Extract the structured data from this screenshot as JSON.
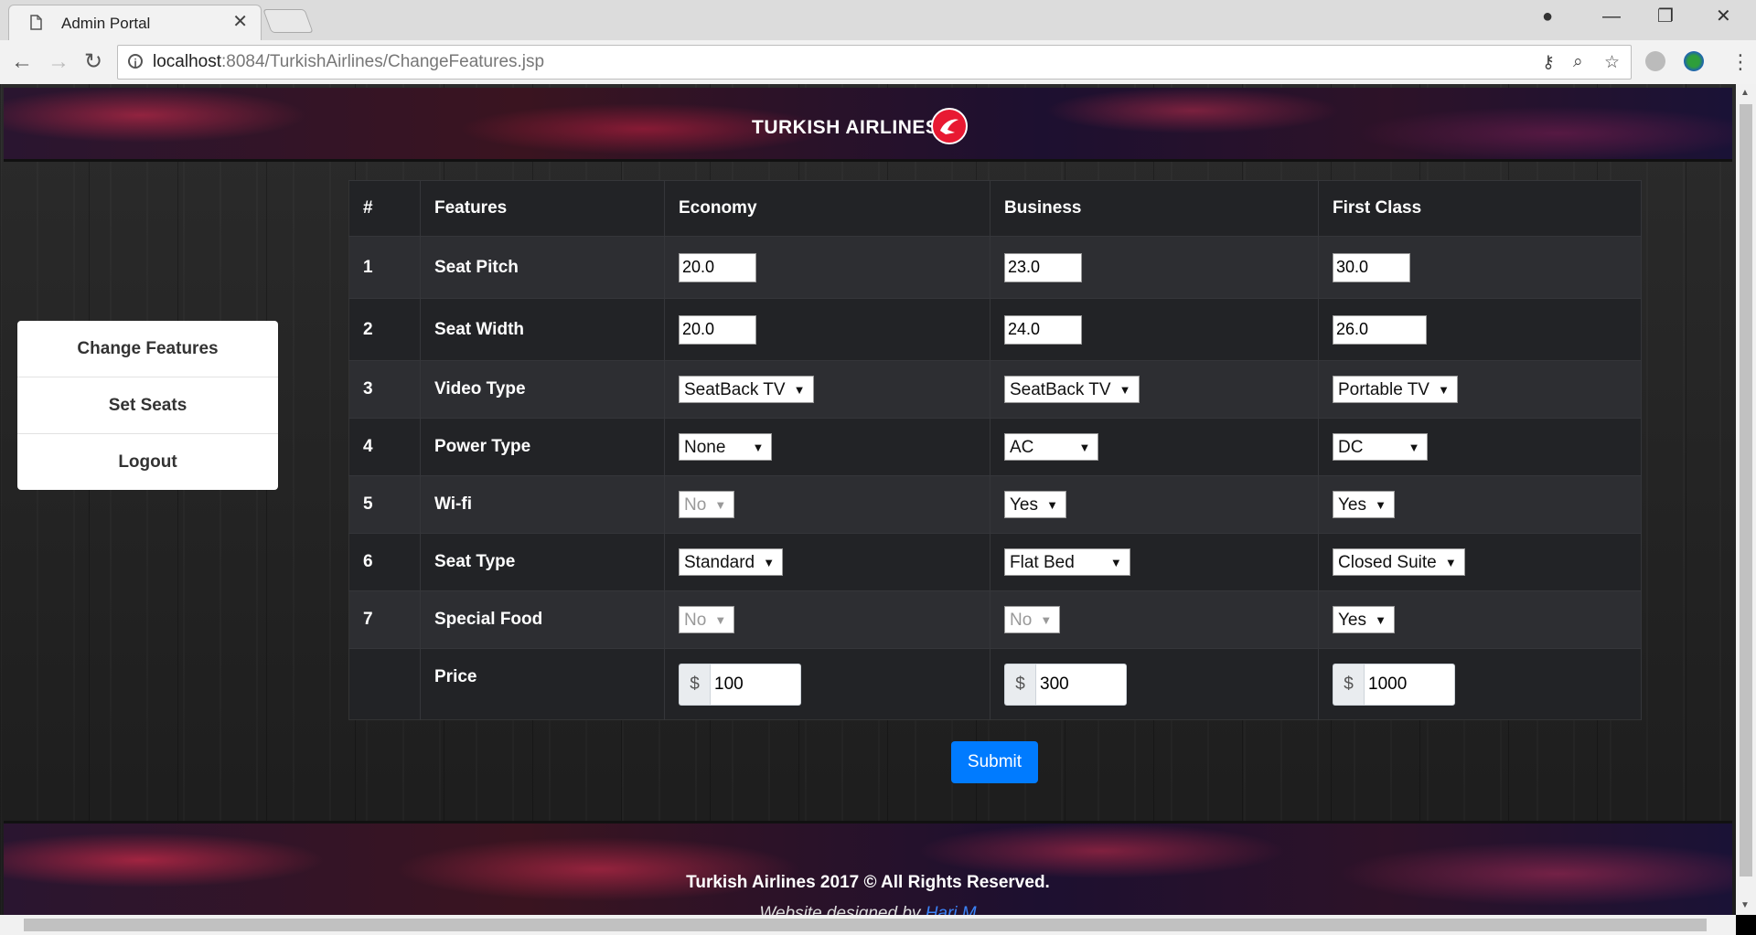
{
  "browser": {
    "tab_title": "Admin Portal",
    "url_host": "localhost",
    "url_path": ":8084/TurkishAirlines/ChangeFeatures.jsp"
  },
  "brand": {
    "name": "TURKISH AIRLINES"
  },
  "sidebar": {
    "items": [
      {
        "label": "Change Features"
      },
      {
        "label": "Set Seats"
      },
      {
        "label": "Logout"
      }
    ]
  },
  "table": {
    "headers": [
      "#",
      "Features",
      "Economy",
      "Business",
      "First Class"
    ],
    "rows": [
      {
        "num": "1",
        "feature": "Seat Pitch",
        "type": "text",
        "economy": "20.0",
        "business": "23.0",
        "first": "30.0"
      },
      {
        "num": "2",
        "feature": "Seat Width",
        "type": "text",
        "economy": "20.0",
        "business": "24.0",
        "first": "26.0"
      },
      {
        "num": "3",
        "feature": "Video Type",
        "type": "select",
        "economy": "SeatBack TV",
        "business": "SeatBack TV",
        "first": "Portable TV"
      },
      {
        "num": "4",
        "feature": "Power Type",
        "type": "select",
        "economy": "None",
        "business": "AC",
        "first": "DC"
      },
      {
        "num": "5",
        "feature": "Wi-fi",
        "type": "select",
        "economy": "No",
        "business": "Yes",
        "first": "Yes"
      },
      {
        "num": "6",
        "feature": "Seat Type",
        "type": "select",
        "economy": "Standard",
        "business": "Flat Bed",
        "first": "Closed Suite"
      },
      {
        "num": "7",
        "feature": "Special Food",
        "type": "select",
        "economy": "No",
        "business": "No",
        "first": "Yes"
      },
      {
        "num": "",
        "feature": "Price",
        "type": "price",
        "currency": "$",
        "economy": "100",
        "business": "300",
        "first": "1000"
      }
    ]
  },
  "submit_label": "Submit",
  "footer": {
    "copyright": "Turkish Airlines 2017 © All Rights Reserved.",
    "credits_prefix": "Website designed by ",
    "credits_link": "Hari M"
  },
  "colors": {
    "accent": "#007bff",
    "brand_red": "#e81932"
  }
}
